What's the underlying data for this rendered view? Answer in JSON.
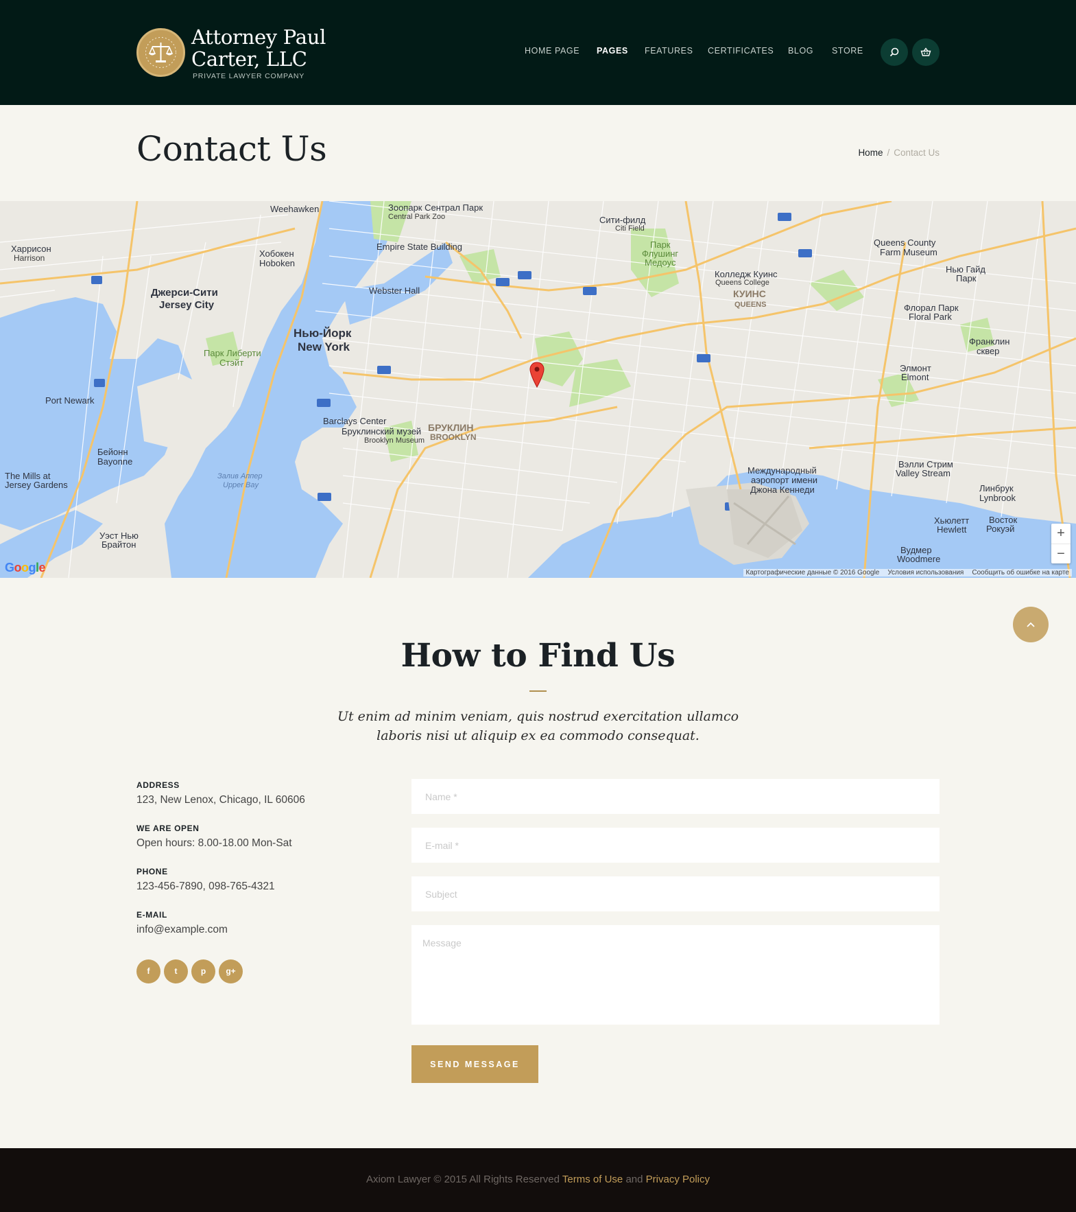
{
  "header": {
    "brand_title_line1": "Attorney Paul",
    "brand_title_line2": "Carter, LLC",
    "brand_subtitle": "PRIVATE LAWYER COMPANY",
    "nav": [
      {
        "label": "HOME PAGE",
        "active": false
      },
      {
        "label": "PAGES",
        "active": true
      },
      {
        "label": "FEATURES",
        "active": false
      },
      {
        "label": "CERTIFICATES",
        "active": false
      },
      {
        "label": "BLOG",
        "active": false
      },
      {
        "label": "STORE",
        "active": false
      }
    ],
    "search_icon": "search-icon",
    "cart_icon": "basket-icon"
  },
  "title_bar": {
    "title": "Contact Us",
    "breadcrumb": {
      "home": "Home",
      "separator": "/",
      "current": "Contact Us"
    }
  },
  "map": {
    "labels": {
      "weehawken": "Weehawken",
      "zoo": "Зоопарк Сентрал Парк",
      "zoo_en": "Central Park Zoo",
      "citi": "Сити-филд",
      "citi_en": "Citi Field",
      "harrison": "Харрисон",
      "harrison_en": "Harrison",
      "hoboken": "Хобокен",
      "hoboken_en": "Hoboken",
      "esb": "Empire State Building",
      "queens_museum": "Queens County",
      "queens_museum2": "Farm Museum",
      "jersey": "Джерси-Сити",
      "jersey_en": "Jersey City",
      "webster": "Webster Hall",
      "college": "Колледж Куинс",
      "college_en": "Queens College",
      "queens": "КУИНС",
      "queens_en": "QUEENS",
      "ny": "Нью-Йорк",
      "ny_en": "New York",
      "liberty": "Парк Либерти",
      "liberty2": "Стэйт",
      "port_newark": "Port Newark",
      "barclays": "Barclays Center",
      "brooklyn_museum": "Бруклинский музей",
      "brooklyn_museum_en": "Brooklyn Museum",
      "brooklyn": "БРУКЛИН",
      "brooklyn_en": "BROOKLYN",
      "bayonne": "Бейонн",
      "bayonne_en": "Bayonne",
      "mills": "The Mills at",
      "mills2": "Jersey Gardens",
      "upper_bay": "Залив Аппер",
      "upper_bay_en": "Upper Bay",
      "jfk": "Международный",
      "jfk2": "аэропорт имени",
      "jfk3": "Джона Кеннеди",
      "flushing": "Парк",
      "flushing2": "Флушинг",
      "flushing3": "Медоус",
      "elmont": "Элмонт",
      "elmont_en": "Elmont",
      "valley": "Вэлли Стрим",
      "valley_en": "Valley Stream",
      "lynbrook": "Линбрук",
      "lynbrook_en": "Lynbrook",
      "franklin": "Франклин",
      "franklin2": "сквер",
      "floral": "Флорал Парк",
      "floral_en": "Floral Park",
      "hyde": "Нью Гайд",
      "hyde2": "Парк",
      "west_brighton": "Уэст Нью",
      "west_brighton2": "Брайтон",
      "woodmere": "Вудмер",
      "woodmere_en": "Woodmere",
      "hewlett": "Хьюлетт",
      "hewlett_en": "Hewlett",
      "rockaway": "Восток",
      "rockaway2": "Рокуэй"
    },
    "zoom_in": "+",
    "zoom_out": "−",
    "google": "Google",
    "attribution": "Картографические данные © 2016 Google",
    "terms": "Условия использования",
    "report": "Сообщить об ошибке на карте"
  },
  "section": {
    "title": "How to Find Us",
    "subtitle_line1": "Ut enim ad minim veniam, quis nostrud exercitation ullamco",
    "subtitle_line2": "laboris nisi ut aliquip ex ea commodo consequat."
  },
  "contact_info": {
    "address_label": "ADDRESS",
    "address_value": "123, New Lenox, Chicago, IL 60606",
    "open_label": "WE ARE OPEN",
    "open_value": "Open hours: 8.00-18.00 Mon-Sat",
    "phone_label": "PHONE",
    "phone_value": "123-456-7890, 098-765-4321",
    "email_label": "E-MAIL",
    "email_value": "info@example.com",
    "social": [
      {
        "icon": "facebook-icon",
        "glyph": "f"
      },
      {
        "icon": "twitter-icon",
        "glyph": "t"
      },
      {
        "icon": "pinterest-icon",
        "glyph": "p"
      },
      {
        "icon": "google-plus-icon",
        "glyph": "g+"
      }
    ]
  },
  "form": {
    "name_placeholder": "Name *",
    "email_placeholder": "E-mail *",
    "subject_placeholder": "Subject",
    "message_placeholder": "Message",
    "submit_label": "SEND MESSAGE"
  },
  "footer": {
    "copyright": "Axiom Lawyer © 2015 All Rights Reserved",
    "terms": "Terms of Use",
    "and": "and",
    "privacy": "Privacy Policy"
  },
  "colors": {
    "header_bg": "#021a16",
    "accent_gold": "#c29d59",
    "page_bg": "#f6f5ef",
    "footer_bg": "#120d0c",
    "water": "#a3ccff",
    "park": "#c8e6a8",
    "highway": "#f6c56a"
  }
}
